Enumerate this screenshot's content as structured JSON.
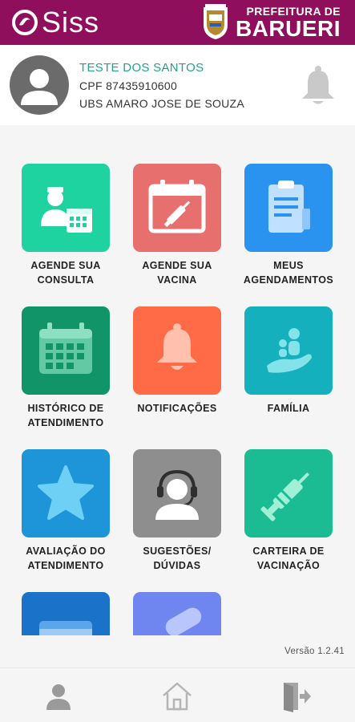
{
  "header": {
    "logo_text": "Siss",
    "brand_line1": "PREFEITURA DE",
    "brand_line2": "BARUERI",
    "color": "#8f0f5c"
  },
  "profile": {
    "name": "TESTE DOS SANTOS",
    "cpf": "CPF 87435910600",
    "ubs": "UBS AMARO JOSE DE SOUZA"
  },
  "menu": [
    {
      "label": "AGENDE SUA CONSULTA",
      "color": "#1ed3a0",
      "icon": "doctor-calendar-icon"
    },
    {
      "label": "AGENDE SUA VACINA",
      "color": "#e7706f",
      "icon": "vaccine-calendar-icon"
    },
    {
      "label": "MEUS AGENDAMENTOS",
      "color": "#2a93ef",
      "icon": "clipboard-icon"
    },
    {
      "label": "HISTÓRICO DE ATENDIMENTO",
      "color": "#119467",
      "icon": "calendar-icon"
    },
    {
      "label": "NOTIFICAÇÕES",
      "color": "#ff6a47",
      "icon": "bell-icon"
    },
    {
      "label": "FAMÍLIA",
      "color": "#15b0bd",
      "icon": "family-hand-icon"
    },
    {
      "label": "AVALIAÇÃO DO ATENDIMENTO",
      "color": "#1d95d8",
      "icon": "star-icon"
    },
    {
      "label": "SUGESTÕES/ DÚVIDAS",
      "color": "#8e8e8e",
      "icon": "headset-icon"
    },
    {
      "label": "CARTEIRA DE VACINAÇÃO",
      "color": "#1bbb93",
      "icon": "syringe-icon"
    },
    {
      "label": "",
      "color": "#1a73c9",
      "icon": "card-icon"
    },
    {
      "label": "",
      "color": "#6f86f0",
      "icon": "pill-icon"
    }
  ],
  "version": "Versão 1.2.41",
  "nav": {
    "items": [
      {
        "icon": "user-icon"
      },
      {
        "icon": "home-icon"
      },
      {
        "icon": "logout-icon"
      }
    ]
  }
}
